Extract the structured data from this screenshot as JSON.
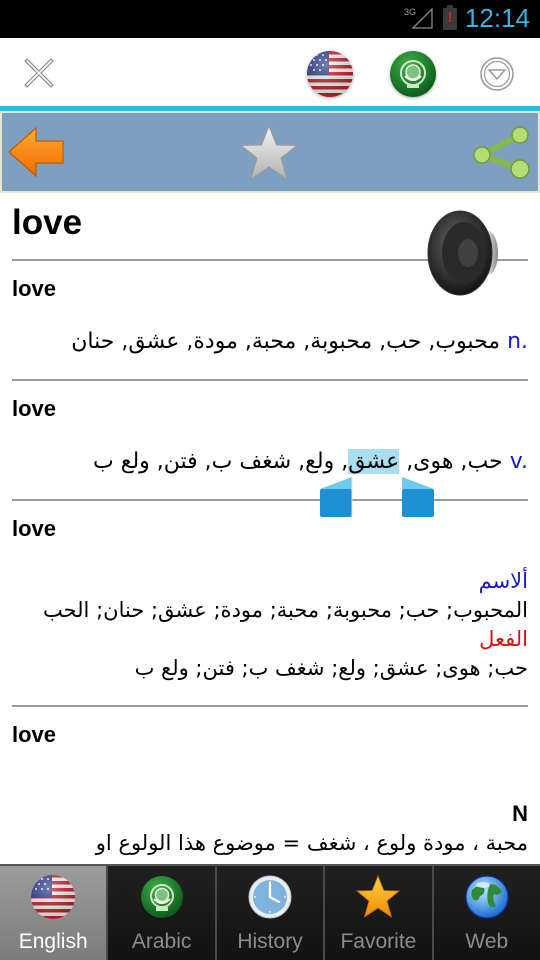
{
  "status_bar": {
    "network": "3G",
    "battery_alert": "!",
    "time": "12:14"
  },
  "top_bar": {
    "close_icon": "close-icon",
    "source_language_icon": "us-flag-icon",
    "target_language_icon": "arab-league-flag-icon",
    "menu_icon": "dropdown-circle-icon"
  },
  "action_bar": {
    "back_icon": "back-arrow-icon",
    "favorite_icon": "star-icon",
    "share_icon": "share-icon",
    "accent_color": "#33b5e5",
    "background_color": "#7f9fc1"
  },
  "entry": {
    "headword": "love",
    "speaker_icon": "speaker-icon",
    "sections": [
      {
        "title": "love",
        "pos": "n.",
        "translation": "محبوب, حب, محبوبة, محبة, مودة, عشق, حنان"
      },
      {
        "title": "love",
        "pos": "v.",
        "translation_before": "حب, هوى, ",
        "translation_selected": "عشق",
        "translation_after": ", ولع, شغف ب, فتن, ولع ب"
      },
      {
        "title": "love",
        "noun_label": "ألاسم",
        "noun_text": "المحبوب; حب; محبوبة; محبة; مودة; عشق; حنان; الحب",
        "verb_label": "الفعل",
        "verb_text": "حب; هوى; عشق; ولع; شغف ب; فتن; ولع ب"
      },
      {
        "title": "love",
        "pos_label": "N",
        "text_line1": "محبة ، مودة ولوع ، شغف = موضوع هذا الولوع او"
      }
    ]
  },
  "tabs": [
    {
      "label": "English",
      "icon": "us-flag-icon",
      "active": true
    },
    {
      "label": "Arabic",
      "icon": "arab-league-flag-icon",
      "active": false
    },
    {
      "label": "History",
      "icon": "clock-icon",
      "active": false
    },
    {
      "label": "Favorite",
      "icon": "star-icon",
      "active": false
    },
    {
      "label": "Web",
      "icon": "globe-icon",
      "active": false
    }
  ]
}
